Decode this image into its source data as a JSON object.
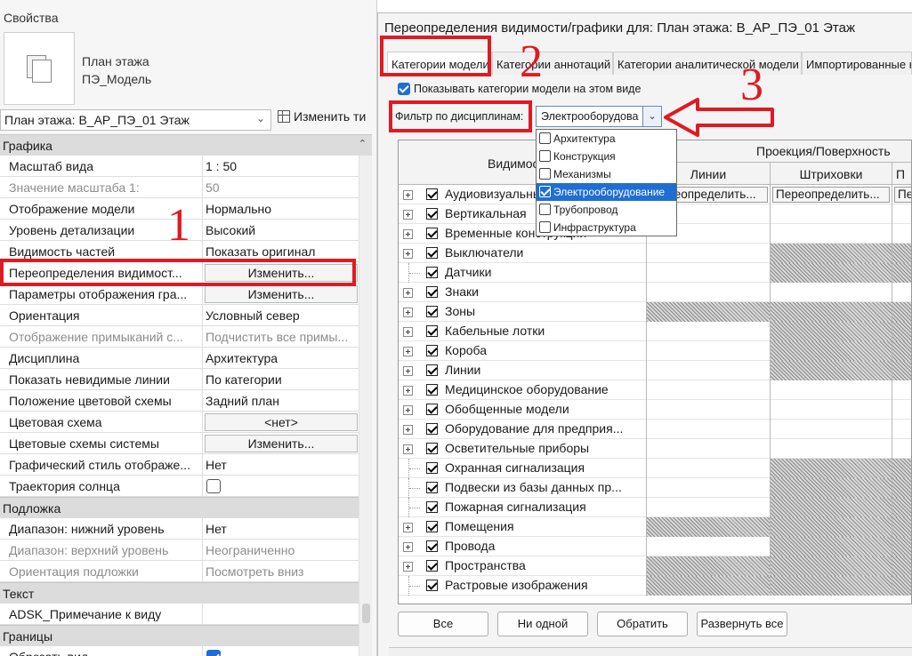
{
  "properties": {
    "title": "Свойства",
    "type_line1": "План этажа",
    "type_line2": "ПЭ_Модель",
    "view_select": "План этажа: В_АР_ПЭ_01 Этаж",
    "edit_type": "Изменить ти",
    "sections": [
      {
        "label": "Графика",
        "rows": [
          {
            "key": "Масштаб вида",
            "value": "1 : 50",
            "kind": "text"
          },
          {
            "key": "Значение масштаба    1:",
            "value": "50",
            "kind": "text",
            "disabled": true
          },
          {
            "key": "Отображение модели",
            "value": "Нормально",
            "kind": "text"
          },
          {
            "key": "Уровень детализации",
            "value": "Высокий",
            "kind": "text"
          },
          {
            "key": "Видимость частей",
            "value": "Показать оригинал",
            "kind": "text"
          },
          {
            "key": "Переопределения видимост...",
            "value": "Изменить...",
            "kind": "button"
          },
          {
            "key": "Параметры отображения гра...",
            "value": "Изменить...",
            "kind": "button"
          },
          {
            "key": "Ориентация",
            "value": "Условный север",
            "kind": "text"
          },
          {
            "key": "Отображение примыканий с...",
            "value": "Подчистить все примы...",
            "kind": "text",
            "disabled": true
          },
          {
            "key": "Дисциплина",
            "value": "Архитектура",
            "kind": "text"
          },
          {
            "key": "Показать невидимые линии",
            "value": "По категории",
            "kind": "text"
          },
          {
            "key": "Положение цветовой схемы",
            "value": "Задний план",
            "kind": "text"
          },
          {
            "key": "Цветовая схема",
            "value": "<нет>",
            "kind": "button"
          },
          {
            "key": "Цветовые схемы системы",
            "value": "Изменить...",
            "kind": "button"
          },
          {
            "key": "Графический стиль отображе...",
            "value": "Нет",
            "kind": "text"
          },
          {
            "key": "Траектория солнца",
            "value": "",
            "kind": "checkbox",
            "checked": false
          }
        ]
      },
      {
        "label": "Подложка",
        "rows": [
          {
            "key": "Диапазон: нижний уровень",
            "value": "Нет",
            "kind": "text"
          },
          {
            "key": "Диапазон: верхний уровень",
            "value": "Неограниченно",
            "kind": "text",
            "disabled": true
          },
          {
            "key": "Ориентация подложки",
            "value": "Посмотреть вниз",
            "kind": "text",
            "disabled": true
          }
        ]
      },
      {
        "label": "Текст",
        "rows": [
          {
            "key": "ADSK_Примечание к виду",
            "value": "",
            "kind": "text"
          }
        ]
      },
      {
        "label": "Границы",
        "rows": [
          {
            "key": "Обрезать вид",
            "value": "",
            "kind": "checkbox",
            "checked": true
          }
        ]
      }
    ]
  },
  "dialog": {
    "title": "Переопределения видимости/графики для: План этажа: В_АР_ПЭ_01 Этаж",
    "tabs": [
      "Категории модели",
      "Категории аннотаций",
      "Категории аналитической модели",
      "Импортированные к"
    ],
    "show_categories": "Показывать категории модели на этом виде",
    "filter_label": "Фильтр по дисциплинам:",
    "filter_value": "Электрооборудова",
    "filter_options": [
      {
        "label": "Архитектура",
        "checked": false
      },
      {
        "label": "Конструкция",
        "checked": false
      },
      {
        "label": "Механизмы",
        "checked": false
      },
      {
        "label": "Электрооборудование",
        "checked": true
      },
      {
        "label": "Трубопровод",
        "checked": false
      },
      {
        "label": "Инфраструктура",
        "checked": false
      }
    ],
    "table": {
      "col_visibility": "Видимос",
      "col_projection": "Проекция/Поверхность",
      "col_lines": "Линии",
      "col_hatch": "Штриховки",
      "col_more": "П",
      "override_text": "Переопределить...",
      "override_short": "Пе",
      "rows": [
        {
          "name": "Аудиовизуальные",
          "expandable": true,
          "hatch": [
            false,
            false,
            false
          ],
          "override": true
        },
        {
          "name": "Вертикальная",
          "expandable": true,
          "hatch": [
            false,
            false,
            false
          ]
        },
        {
          "name": "Временные конструкции",
          "expandable": true,
          "hatch": [
            false,
            false,
            false
          ]
        },
        {
          "name": "Выключатели",
          "expandable": true,
          "hatch": [
            false,
            true,
            true
          ]
        },
        {
          "name": "Датчики",
          "expandable": false,
          "hatch": [
            false,
            true,
            true
          ]
        },
        {
          "name": "Знаки",
          "expandable": true,
          "hatch": [
            false,
            false,
            false
          ]
        },
        {
          "name": "Зоны",
          "expandable": true,
          "hatch": [
            true,
            true,
            true
          ]
        },
        {
          "name": "Кабельные лотки",
          "expandable": true,
          "hatch": [
            false,
            true,
            true
          ]
        },
        {
          "name": "Короба",
          "expandable": true,
          "hatch": [
            false,
            true,
            true
          ]
        },
        {
          "name": "Линии",
          "expandable": true,
          "hatch": [
            false,
            true,
            true
          ]
        },
        {
          "name": "Медицинское оборудование",
          "expandable": true,
          "hatch": [
            false,
            false,
            false
          ]
        },
        {
          "name": "Обобщенные модели",
          "expandable": true,
          "hatch": [
            false,
            false,
            false
          ]
        },
        {
          "name": "Оборудование для предприя...",
          "expandable": true,
          "hatch": [
            false,
            false,
            false
          ]
        },
        {
          "name": "Осветительные приборы",
          "expandable": true,
          "hatch": [
            false,
            false,
            false
          ]
        },
        {
          "name": "Охранная сигнализация",
          "expandable": false,
          "hatch": [
            false,
            true,
            true
          ]
        },
        {
          "name": "Подвески из базы данных пр...",
          "expandable": false,
          "hatch": [
            false,
            true,
            true
          ]
        },
        {
          "name": "Пожарная сигнализация",
          "expandable": false,
          "hatch": [
            false,
            true,
            true
          ]
        },
        {
          "name": "Помещения",
          "expandable": true,
          "hatch": [
            true,
            true,
            true
          ]
        },
        {
          "name": "Провода",
          "expandable": true,
          "hatch": [
            false,
            true,
            true
          ]
        },
        {
          "name": "Пространства",
          "expandable": true,
          "hatch": [
            true,
            true,
            true
          ]
        },
        {
          "name": "Растровые изображения",
          "expandable": false,
          "hatch": [
            true,
            true,
            true
          ]
        }
      ]
    },
    "buttons": [
      "Все",
      "Ни одной",
      "Обратить",
      "Развернуть все"
    ]
  },
  "annotations": {
    "mark1": "1",
    "mark2": "2",
    "mark3": "3"
  },
  "colors": {
    "annotation_red": "#e01a22",
    "accent_blue": "#1f6ed4"
  }
}
